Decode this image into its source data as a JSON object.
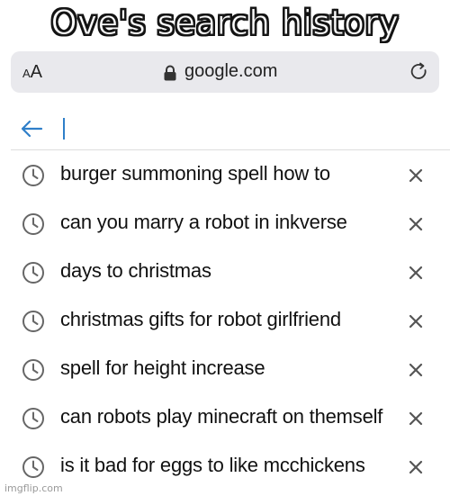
{
  "meme": {
    "title": "Ove's search history"
  },
  "browser": {
    "text_size_button": {
      "small": "A",
      "large": "A"
    },
    "lock_icon": "lock-icon",
    "url": "google.com",
    "reload_icon": "reload-icon"
  },
  "search": {
    "back_icon": "arrow-left-icon",
    "value": "",
    "accent_color": "#2f7fc9"
  },
  "history": {
    "item_icon": "clock-icon",
    "remove_icon": "close-icon",
    "items": [
      {
        "text": "burger summoning spell how to"
      },
      {
        "text": "can you marry a robot in inkverse"
      },
      {
        "text": "days to christmas"
      },
      {
        "text": "christmas gifts for robot girlfriend"
      },
      {
        "text": "spell for height increase"
      },
      {
        "text": "can robots play minecraft on themself"
      },
      {
        "text": "is it bad for eggs to like mcchickens"
      }
    ]
  },
  "watermark": "imgflip.com"
}
